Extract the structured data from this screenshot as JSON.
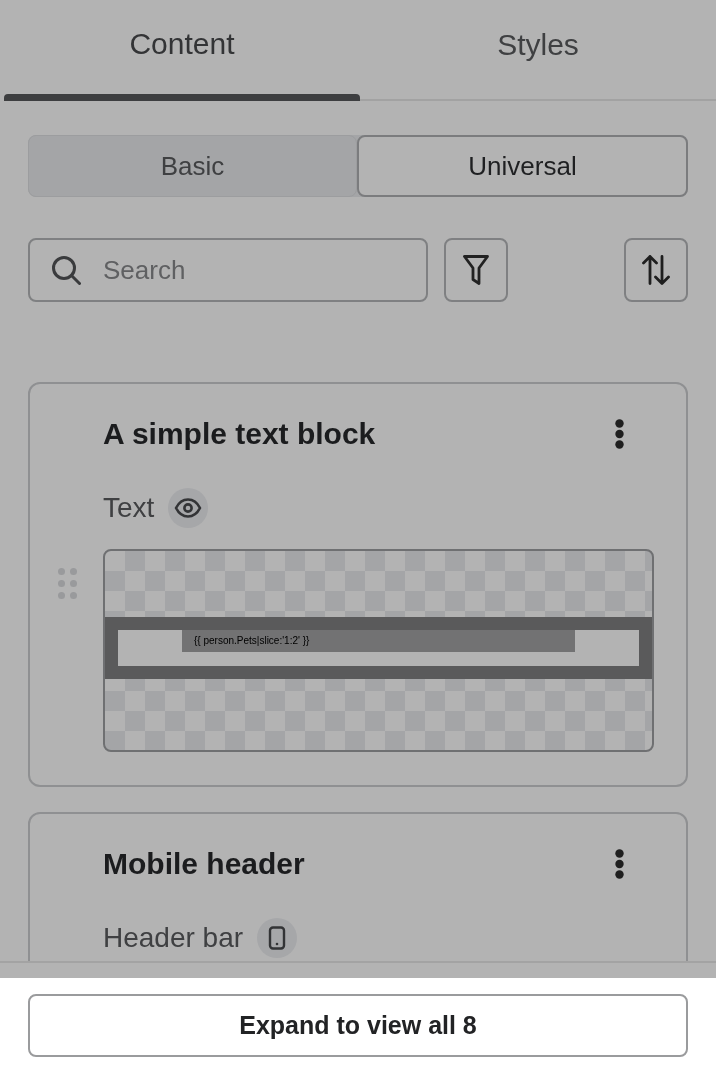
{
  "tabs": [
    {
      "label": "Content",
      "selected": true
    },
    {
      "label": "Styles",
      "selected": false
    }
  ],
  "segments": [
    {
      "label": "Basic",
      "selected": true
    },
    {
      "label": "Universal",
      "selected": false
    }
  ],
  "search": {
    "placeholder": "Search"
  },
  "cards": [
    {
      "title": "A simple text block",
      "type_label": "Text",
      "kind": "eye",
      "preview": {
        "code": "{{ person.Pets|slice:'1:2' }}"
      }
    },
    {
      "title": "Mobile header",
      "type_label": "Header bar",
      "kind": "mobile"
    }
  ],
  "expand_button": {
    "label": "Expand to view all 8"
  }
}
